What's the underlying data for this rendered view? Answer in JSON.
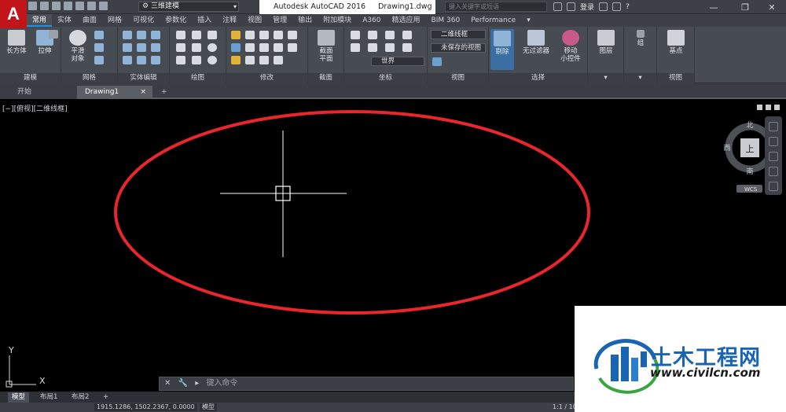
{
  "app": {
    "logo": "A",
    "workspace": "三维建模",
    "title": "Autodesk AutoCAD 2016",
    "filename": "Drawing1.dwg",
    "search_placeholder": "键入关键字或短语",
    "login": "登录",
    "help": "?"
  },
  "ribbon_tabs": [
    "常用",
    "实体",
    "曲面",
    "网格",
    "可视化",
    "参数化",
    "插入",
    "注释",
    "视图",
    "管理",
    "输出",
    "附加模块",
    "A360",
    "精选应用",
    "BIM 360",
    "Performance"
  ],
  "ribbon": {
    "modeling": {
      "label": "建模",
      "box": "长方体",
      "extrude": "拉伸"
    },
    "mesh": {
      "label": "网格",
      "smooth": "平滑\n对象"
    },
    "solid_edit": {
      "label": "实体编辑"
    },
    "draw": {
      "label": "绘图"
    },
    "modify": {
      "label": "修改"
    },
    "section": {
      "label": "截面",
      "plane": "截面\n平面"
    },
    "coords": {
      "label": "坐标",
      "world": "世界"
    },
    "view": {
      "label": "视图",
      "visual_style": "二维线框",
      "saved_view": "未保存的视图"
    },
    "selection": {
      "label": "选择",
      "cull": "剔除",
      "no_filter": "无过滤器",
      "gizmo": "移动\n小控件"
    },
    "layers": {
      "label": "图层"
    },
    "groups": {
      "label": "组"
    },
    "view2": {
      "label": "视图",
      "base": "基点"
    }
  },
  "doc_tabs": {
    "start": "开始",
    "drawing": "Drawing1"
  },
  "viewport": {
    "label": "[−][俯视][二维线框]",
    "viewcube": {
      "top": "上",
      "north": "北",
      "south": "南",
      "east": "东",
      "west": "西",
      "wcs": "WCS"
    },
    "ucs": {
      "x": "X",
      "y": "Y"
    }
  },
  "command": {
    "placeholder": "键入命令"
  },
  "layout_tabs": [
    "模型",
    "布局1",
    "布局2"
  ],
  "status": {
    "coords": "1915.1286, 1502.2367, 0.0000",
    "mode": "模型",
    "scale": "1:1 / 100%"
  },
  "watermark": {
    "title": "土木工程网",
    "url": "www.civilcn.com"
  },
  "colors": {
    "ellipse": "#e8262b",
    "crosshair": "#ffffff",
    "accent": "#1f8fe0"
  }
}
